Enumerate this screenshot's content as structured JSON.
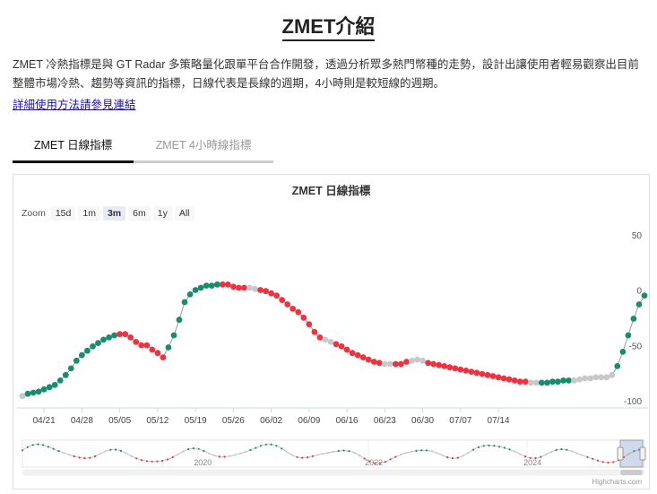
{
  "page": {
    "title": "ZMET介紹",
    "description": "ZMET 冷熱指標是與 GT Radar 多策略量化跟單平台合作開發，透過分析眾多熱門幣種的走勢，設計出讓使用者輕易觀察出目前整體市場冷熱、趨勢等資訊的指標，日線代表是長線的週期，4小時則是較短線的週期。",
    "link": "詳細使用方法請參見連結"
  },
  "tabs": [
    {
      "label": "ZMET 日線指標",
      "active": true
    },
    {
      "label": "ZMET 4小時線指標",
      "active": false
    }
  ],
  "zoom": {
    "label": "Zoom",
    "buttons": [
      "15d",
      "1m",
      "3m",
      "6m",
      "1y",
      "All"
    ],
    "selected": "3m"
  },
  "credit": "Highcharts.com",
  "colors": {
    "hot": "#ee3340",
    "cold": "#1a8c6e",
    "neutral": "#c8c8c8",
    "line": "#9a9a9a"
  },
  "chart_data": {
    "type": "scatter",
    "title": "ZMET 日線指標",
    "x_tick_labels": [
      "04/21",
      "04/28",
      "05/05",
      "05/12",
      "05/19",
      "05/26",
      "06/02",
      "06/09",
      "06/16",
      "06/23",
      "06/30",
      "07/07",
      "07/14"
    ],
    "y_tick_labels": [
      "50",
      "0",
      "-50",
      "-100"
    ],
    "ylim": [
      -105,
      55
    ],
    "grid": false,
    "legend": "none",
    "navigator_labels": [
      "2020",
      "2022",
      "2024"
    ],
    "series": [
      {
        "values": [
          -95,
          -93,
          -92,
          -91,
          -89,
          -87,
          -85,
          -81,
          -76,
          -70,
          -63,
          -58,
          -54,
          -50,
          -47,
          -44,
          -42,
          -40,
          -39,
          -39,
          -42,
          -46,
          -49,
          -49,
          -53,
          -56,
          -60,
          -51,
          -40,
          -26,
          -10,
          -3,
          1,
          3,
          5,
          5,
          6,
          6,
          6,
          4,
          3,
          3,
          3,
          2,
          1,
          0,
          -2,
          -4,
          -8,
          -12,
          -16,
          -19,
          -24,
          -30,
          -37,
          -42,
          -44,
          -46,
          -48,
          -50,
          -53,
          -56,
          -58,
          -60,
          -62,
          -64,
          -65,
          -66,
          -66,
          -66,
          -66,
          -64,
          -63,
          -62,
          -63,
          -65,
          -66,
          -67,
          -68,
          -69,
          -70,
          -71,
          -72,
          -73,
          -74,
          -75,
          -76,
          -77,
          -78,
          -79,
          -80,
          -81,
          -82,
          -82,
          -83,
          -83,
          -83,
          -83,
          -82,
          -82,
          -81,
          -81,
          -81,
          -80,
          -79,
          -79,
          -78,
          -78,
          -78,
          -76,
          -68,
          -55,
          -40,
          -25,
          -12,
          -4
        ],
        "states": [
          "n",
          "c",
          "c",
          "c",
          "c",
          "c",
          "c",
          "c",
          "c",
          "c",
          "c",
          "c",
          "c",
          "c",
          "c",
          "c",
          "c",
          "c",
          "h",
          "h",
          "h",
          "h",
          "h",
          "h",
          "h",
          "h",
          "h",
          "c",
          "c",
          "c",
          "c",
          "c",
          "c",
          "c",
          "c",
          "c",
          "c",
          "h",
          "h",
          "h",
          "h",
          "h",
          "n",
          "n",
          "h",
          "h",
          "h",
          "h",
          "h",
          "h",
          "h",
          "h",
          "h",
          "h",
          "h",
          "h",
          "n",
          "n",
          "h",
          "h",
          "h",
          "h",
          "h",
          "h",
          "h",
          "h",
          "h",
          "n",
          "n",
          "h",
          "h",
          "h",
          "n",
          "n",
          "n",
          "h",
          "h",
          "h",
          "h",
          "h",
          "h",
          "h",
          "h",
          "h",
          "h",
          "h",
          "h",
          "h",
          "h",
          "h",
          "h",
          "h",
          "h",
          "h",
          "n",
          "n",
          "c",
          "c",
          "c",
          "c",
          "c",
          "c",
          "n",
          "n",
          "n",
          "n",
          "n",
          "n",
          "n",
          "n",
          "c",
          "c",
          "c",
          "c",
          "c",
          "c"
        ]
      }
    ]
  }
}
